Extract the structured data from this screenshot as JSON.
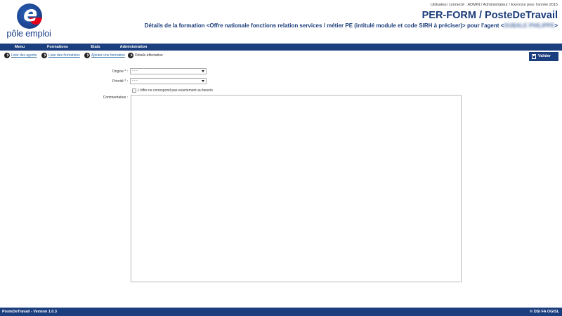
{
  "logo": {
    "text": "pôle emploi"
  },
  "header": {
    "user_info": "Utilisateur connecté : ADMIN / Administrateur / Exercice pour l'année 2015",
    "app_title": "PER-FORM / PosteDeTravail",
    "page_title_prefix": "Détails de la formation <Offre nationale fonctions relation services / métier PE (intitulé module et code SIRH à préciser)> pour l'agent <",
    "agent_name": "DUBALE PHILIPPE",
    "page_title_suffix": ">"
  },
  "menu": {
    "items": [
      "Menu",
      "Formations",
      "Etats",
      "Administration"
    ]
  },
  "breadcrumb": {
    "items": [
      {
        "label": "Liste des agents",
        "link": true
      },
      {
        "label": "Liste des formations",
        "link": true
      },
      {
        "label": "Ajouter une formation",
        "link": true
      },
      {
        "label": "Détails affectation",
        "link": false
      }
    ]
  },
  "actions": {
    "valider_label": "Valider"
  },
  "form": {
    "origine_label": "Origine * :",
    "origine_value": "- - -",
    "priorite_label": "Priorité * :",
    "priorite_value": "- - -",
    "checkbox_label": "L'offre ne correspond pas exactement au besoin",
    "checkbox_checked": false,
    "commentaires_label": "Commentaires :",
    "commentaires_value": ""
  },
  "footer": {
    "left": "PosteDeTravail - Version 1.0.3",
    "right": "© DSI FA OGISL"
  },
  "colors": {
    "brand_blue": "#1b3e7e",
    "link_blue": "#2b6aa6",
    "logo_red": "#e2001a"
  }
}
